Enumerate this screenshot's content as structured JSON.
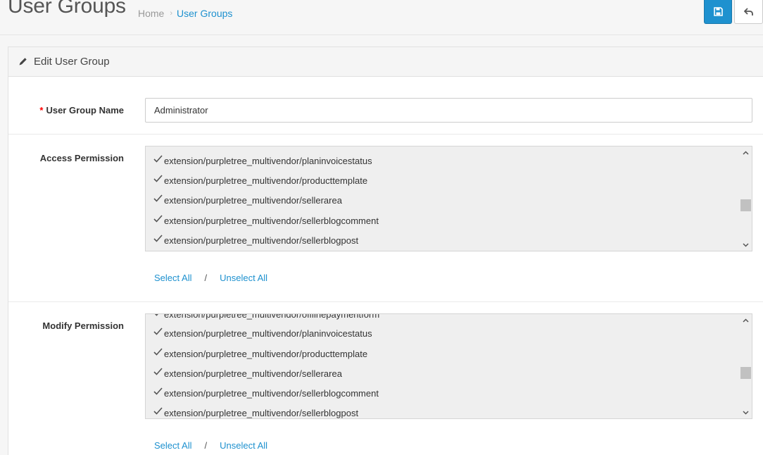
{
  "header": {
    "title": "User Groups",
    "breadcrumb": [
      {
        "label": "Home"
      },
      {
        "label": "User Groups"
      }
    ],
    "breadcrumb_separator": "›"
  },
  "panel": {
    "title": "Edit User Group"
  },
  "form": {
    "name_label": "User Group Name",
    "required_mark": "*",
    "name_value": "Administrator",
    "access": {
      "label": "Access Permission",
      "items": [
        "extension/purpletree_multivendor/planinvoicestatus",
        "extension/purpletree_multivendor/producttemplate",
        "extension/purpletree_multivendor/sellerarea",
        "extension/purpletree_multivendor/sellerblogcomment",
        "extension/purpletree_multivendor/sellerblogpost"
      ],
      "select_all": "Select All",
      "separator": "/",
      "unselect_all": "Unselect All"
    },
    "modify": {
      "label": "Modify Permission",
      "items": [
        "extension/purpletree_multivendor/offlinepaymentform",
        "extension/purpletree_multivendor/planinvoicestatus",
        "extension/purpletree_multivendor/producttemplate",
        "extension/purpletree_multivendor/sellerarea",
        "extension/purpletree_multivendor/sellerblogcomment",
        "extension/purpletree_multivendor/sellerblogpost"
      ],
      "select_all": "Select All",
      "separator": "/",
      "unselect_all": "Unselect All"
    }
  },
  "colors": {
    "primary": "#1e91cf",
    "required": "#ff0000",
    "list_bg": "#efefef"
  },
  "icons": {
    "save": "save-icon",
    "back": "reply-icon",
    "edit": "pencil-icon",
    "checkbox": "checkmark-icon"
  }
}
